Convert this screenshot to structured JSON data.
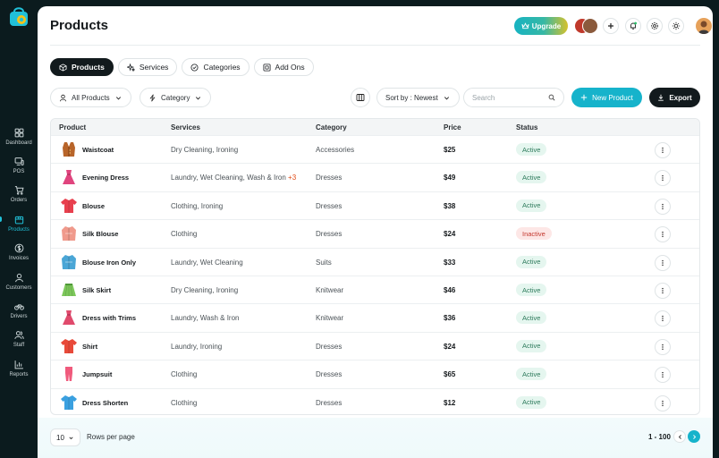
{
  "sidebar": {
    "items": [
      {
        "label": "Dashboard",
        "icon": "grid-icon",
        "active": false
      },
      {
        "label": "POS",
        "icon": "pos-icon",
        "active": false
      },
      {
        "label": "Orders",
        "icon": "cart-icon",
        "active": false
      },
      {
        "label": "Products",
        "icon": "box-icon",
        "active": true
      },
      {
        "label": "Invoices",
        "icon": "dollar-icon",
        "active": false
      },
      {
        "label": "Customers",
        "icon": "user-icon",
        "active": false
      },
      {
        "label": "Drivers",
        "icon": "bike-icon",
        "active": false
      },
      {
        "label": "Staff",
        "icon": "users-icon",
        "active": false
      },
      {
        "label": "Reports",
        "icon": "chart-icon",
        "active": false
      }
    ]
  },
  "header": {
    "title": "Products",
    "upgrade_label": "Upgrade"
  },
  "tabs": [
    {
      "label": "Products",
      "icon": "box-icon",
      "active": true
    },
    {
      "label": "Services",
      "icon": "sparkle-icon",
      "active": false
    },
    {
      "label": "Categories",
      "icon": "check-circle-icon",
      "active": false
    },
    {
      "label": "Add Ons",
      "icon": "plus-square-icon",
      "active": false
    }
  ],
  "filters": {
    "products_label": "All Products",
    "category_label": "Category",
    "sort_label": "Sort by : Newest",
    "search_placeholder": "Search",
    "new_product_label": "New Product",
    "export_label": "Export"
  },
  "table": {
    "columns": [
      "Product",
      "Services",
      "Category",
      "Price",
      "Status"
    ],
    "rows": [
      {
        "product": "Waistcoat",
        "services": "Dry Cleaning, Ironing",
        "more": "",
        "category": "Accessories",
        "price": "$25",
        "status": "Active",
        "thumb": "waistcoat",
        "color": "#b8652a"
      },
      {
        "product": "Evening Dress",
        "services": "Laundry, Wet Cleaning, Wash & Iron",
        "more": "+3",
        "category": "Dresses",
        "price": "$49",
        "status": "Active",
        "thumb": "dress",
        "color": "#e0447e"
      },
      {
        "product": "Blouse",
        "services": "Clothing, Ironing",
        "more": "",
        "category": "Dresses",
        "price": "$38",
        "status": "Active",
        "thumb": "shirt",
        "color": "#e8404e"
      },
      {
        "product": "Silk Blouse",
        "services": "Clothing",
        "more": "",
        "category": "Dresses",
        "price": "$24",
        "status": "Inactive",
        "thumb": "coat",
        "color": "#f09a8c"
      },
      {
        "product": "Blouse Iron Only",
        "services": "Laundry, Wet Cleaning",
        "more": "",
        "category": "Suits",
        "price": "$33",
        "status": "Active",
        "thumb": "coat",
        "color": "#4aa6d6"
      },
      {
        "product": "Silk Skirt",
        "services": "Dry Cleaning, Ironing",
        "more": "",
        "category": "Knitwear",
        "price": "$46",
        "status": "Active",
        "thumb": "skirt",
        "color": "#7cc75a"
      },
      {
        "product": "Dress with Trims",
        "services": "Laundry, Wash & Iron",
        "more": "",
        "category": "Knitwear",
        "price": "$36",
        "status": "Active",
        "thumb": "dress",
        "color": "#e04a6c"
      },
      {
        "product": "Shirt",
        "services": "Laundry, Ironing",
        "more": "",
        "category": "Dresses",
        "price": "$24",
        "status": "Active",
        "thumb": "shirt",
        "color": "#e84a3a"
      },
      {
        "product": "Jumpsuit",
        "services": "Clothing",
        "more": "",
        "category": "Dresses",
        "price": "$65",
        "status": "Active",
        "thumb": "jumpsuit",
        "color": "#f05a7c"
      },
      {
        "product": "Dress Shorten",
        "services": "Clothing",
        "more": "",
        "category": "Dresses",
        "price": "$12",
        "status": "Active",
        "thumb": "shirt",
        "color": "#3aa0e0"
      }
    ]
  },
  "footer": {
    "rows_value": "10",
    "rows_label": "Rows per page",
    "range": "1 - 100"
  },
  "colors": {
    "accent": "#16b3cb",
    "dark": "#121a1d",
    "active_badge": "#e5f6ef",
    "inactive_badge": "#fde7e6"
  }
}
